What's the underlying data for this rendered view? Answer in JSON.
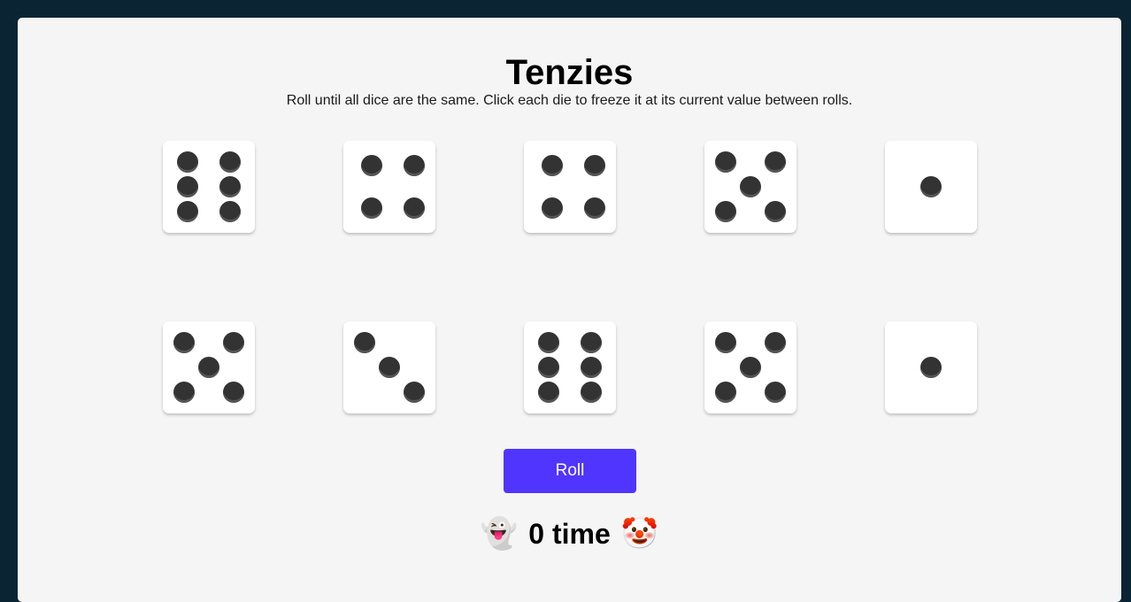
{
  "game": {
    "title": "Tenzies",
    "instructions": "Roll until all dice are the same. Click each die to freeze it at its current value between rolls."
  },
  "dice": [
    {
      "value": 6,
      "held": false
    },
    {
      "value": 4,
      "held": false
    },
    {
      "value": 4,
      "held": false
    },
    {
      "value": 5,
      "held": false
    },
    {
      "value": 1,
      "held": false
    },
    {
      "value": 5,
      "held": false
    },
    {
      "value": 3,
      "held": false
    },
    {
      "value": 6,
      "held": false
    },
    {
      "value": 5,
      "held": false
    },
    {
      "value": 1,
      "held": false
    }
  ],
  "controls": {
    "roll_label": "Roll"
  },
  "status": {
    "left_emoji": "👻",
    "count_text": "0 time",
    "right_emoji": "🤡"
  }
}
